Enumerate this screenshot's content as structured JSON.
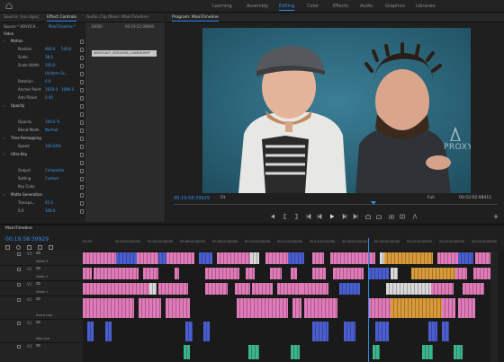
{
  "topbar": {
    "workspaces": [
      "Learning",
      "Assembly",
      "Editing",
      "Color",
      "Effects",
      "Audio",
      "Graphics",
      "Libraries"
    ],
    "active_index": 2
  },
  "effect_controls": {
    "tabs": [
      "Source: (no clips)",
      "Effect Controls",
      "Audio Clip Mixer: MainTimeline"
    ],
    "active_tab": 1,
    "header_source": "Source * ADVOCA...",
    "header_seq": "MainTimeline *",
    "mini_tc_start": "10000",
    "mini_tc_end": "00:19:52:09800",
    "clip_name": "ADVOCACY_5051(900)_CANON.MXF",
    "section_video": "Video",
    "properties": [
      {
        "label": "Motion",
        "kind": "section"
      },
      {
        "label": "Position",
        "v1": "960.0",
        "v2": "540.0"
      },
      {
        "label": "Scale",
        "v1": "38.0"
      },
      {
        "label": "Scale Width",
        "v1": "100.0"
      },
      {
        "label": "",
        "v1": "Uniform Sc..."
      },
      {
        "label": "Rotation",
        "v1": "0.0"
      },
      {
        "label": "Anchor Point",
        "v1": "1920.0",
        "v2": "1080.0"
      },
      {
        "label": "Anti-flicker",
        "v1": "0.00"
      },
      {
        "label": "Opacity",
        "kind": "section"
      },
      {
        "label": "",
        "v1": ""
      },
      {
        "label": "Opacity",
        "v1": "100.0 %"
      },
      {
        "label": "Blend Mode",
        "v1": "Normal"
      },
      {
        "label": "Time Remapping",
        "kind": "section"
      },
      {
        "label": "Speed",
        "v1": "100.00%"
      },
      {
        "label": "Ultra Key",
        "kind": "section"
      },
      {
        "label": "",
        "v1": ""
      },
      {
        "label": "Output",
        "v1": "Composite"
      },
      {
        "label": "Setting",
        "v1": "Custom"
      },
      {
        "label": "Key Color",
        "v1": ""
      },
      {
        "label": "Matte Generation",
        "kind": "section"
      },
      {
        "label": "Transpa...",
        "v1": "45.0"
      },
      {
        "label": "0.0",
        "v1": "100.0"
      }
    ],
    "timecode": "00:19:58:39929"
  },
  "program_monitor": {
    "tab": "Program: MainTimeline",
    "watermark": "PROXY",
    "left_timecode": "00:19:58:39929",
    "fit": "Fit",
    "full": "Full",
    "right_timecode": "00:52:02:08411",
    "playhead_fraction": 0.61
  },
  "timeline": {
    "tab": "MainTimeline",
    "timecode": "00:19:58:39929",
    "ruler": [
      "00:00",
      "00:02:00:00000",
      "00:04:00:00000",
      "00:06:00:00000",
      "00:08:00:00000",
      "00:10:00:00000",
      "00:12:00:00000",
      "00:14:00:00000",
      "00:16:00:00000",
      "00:18:00:00000",
      "00:20:00:00000",
      "00:22:00:00000",
      "00:24:00:00000"
    ],
    "tracks": [
      {
        "id": "V3",
        "name": "Video 3"
      },
      {
        "id": "V2",
        "name": "Video 2"
      },
      {
        "id": "V1",
        "name": "Video 1"
      },
      {
        "id": "A1",
        "name": "Event Live"
      },
      {
        "id": "A2",
        "name": "Mas Live"
      },
      {
        "id": "A3",
        "name": ""
      }
    ]
  },
  "colors": {
    "accent": "#2d8ceb",
    "clip_pink": "#e07ab8",
    "clip_blue": "#4a5ed0",
    "clip_orange": "#d99a3a",
    "clip_teal": "#3bb58f",
    "clip_white": "#d8d8d8"
  }
}
